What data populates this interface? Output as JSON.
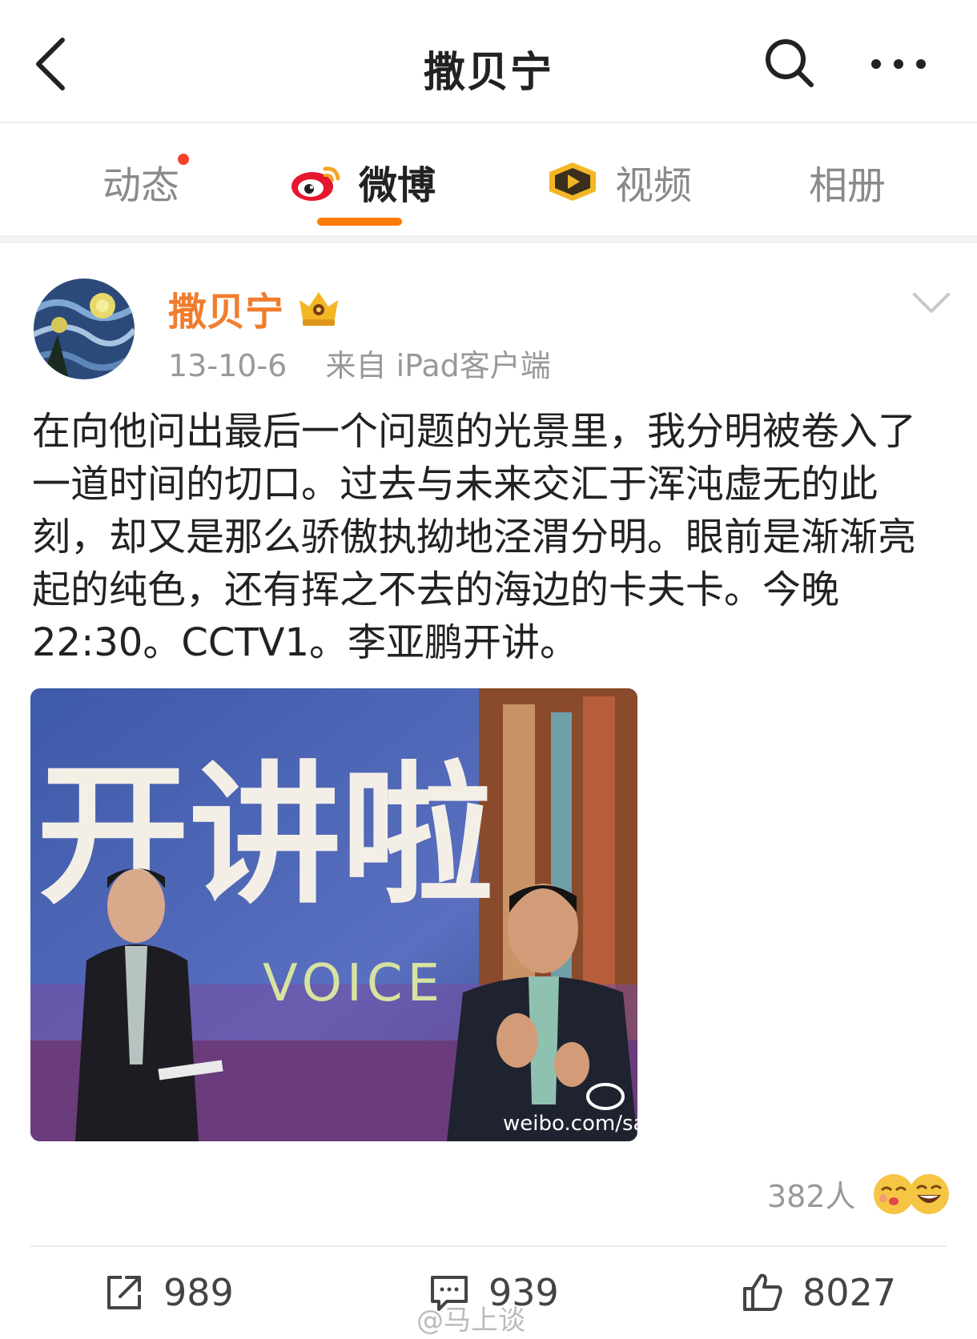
{
  "topbar": {
    "title": "撒贝宁",
    "back_icon": "chevron-left-icon",
    "search_icon": "search-icon",
    "more_icon": "more-horizontal-icon"
  },
  "tabs": [
    {
      "label": "动态",
      "badge": true,
      "active": false
    },
    {
      "label": "微博",
      "icon": "weibo-logo-icon",
      "active": true
    },
    {
      "label": "视频",
      "icon": "video-play-icon",
      "active": false
    },
    {
      "label": "相册",
      "active": false
    }
  ],
  "post": {
    "author": "撒贝宁",
    "badge_icon": "crown-badge-icon",
    "date": "13-10-6",
    "source": "来自 iPad客户端",
    "text": "在向他问出最后一个问题的光景里，我分明被卷入了一道时间的切口。过去与未来交汇于浑沌虚无的此刻，却又是那么骄傲执拗地泾渭分明。眼前是渐渐亮起的纯色，还有挥之不去的海边的卡夫卡。今晚22:30。CCTV1。李亚鹏开讲。",
    "image": {
      "sign_text": "开讲啦",
      "voice_text": "VOICE",
      "watermark": "weibo.com/sal"
    },
    "reactions": {
      "count": "382人"
    },
    "actions": {
      "repost": "989",
      "comment": "939",
      "like": "8027"
    }
  },
  "watermark": "@马上谈",
  "colors": {
    "accent": "#ff7a00",
    "username": "#f07d2d",
    "badge_dot": "#f5402c"
  }
}
